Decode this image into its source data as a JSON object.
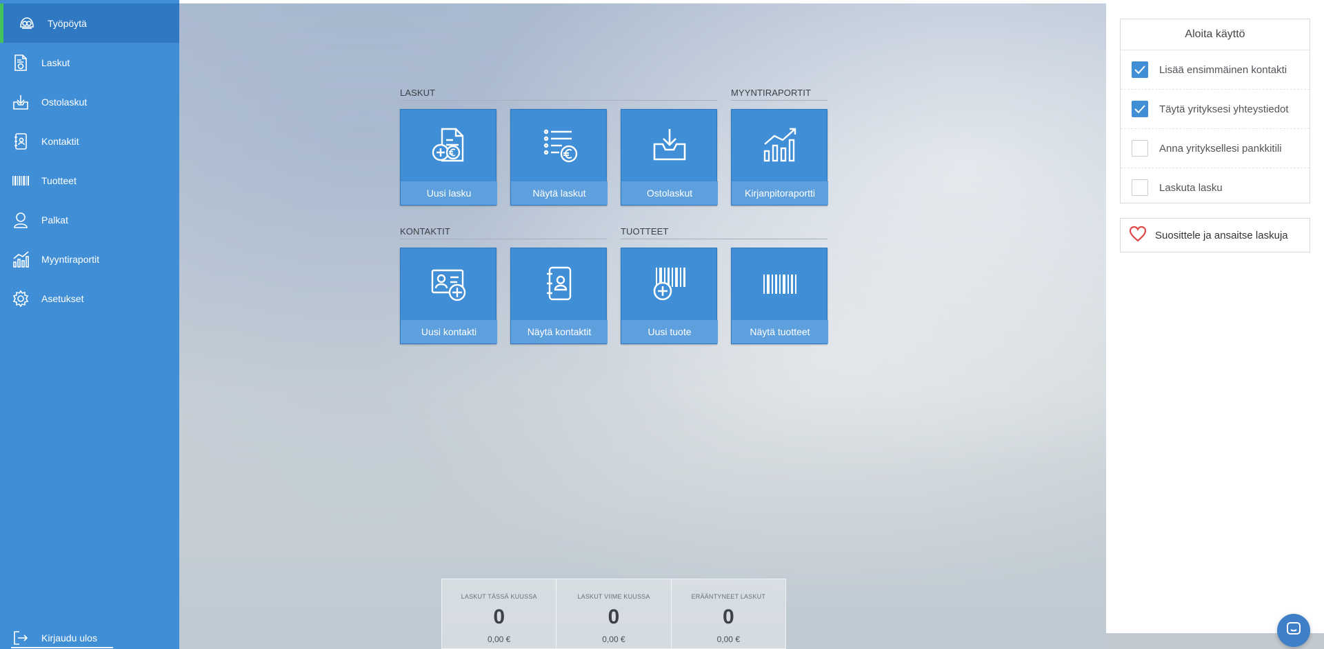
{
  "sidebar": {
    "items": [
      {
        "label": "Työpöytä",
        "icon": "dashboard-icon",
        "active": true
      },
      {
        "label": "Laskut",
        "icon": "invoice-icon"
      },
      {
        "label": "Ostolaskut",
        "icon": "inbox-icon"
      },
      {
        "label": "Kontaktit",
        "icon": "contact-book-icon"
      },
      {
        "label": "Tuotteet",
        "icon": "barcode-icon"
      },
      {
        "label": "Palkat",
        "icon": "person-icon"
      },
      {
        "label": "Myyntiraportit",
        "icon": "chart-icon"
      },
      {
        "label": "Asetukset",
        "icon": "gear-icon"
      }
    ],
    "logout": {
      "label": "Kirjaudu ulos",
      "icon": "logout-icon"
    }
  },
  "sections": {
    "laskut": "LASKUT",
    "myyntiraportit": "MYYNTIRAPORTIT",
    "kontaktit": "KONTAKTIT",
    "tuotteet": "TUOTTEET"
  },
  "tiles": {
    "new_invoice": "Uusi lasku",
    "show_invoices": "Näytä laskut",
    "purchase_invoices": "Ostolaskut",
    "accounting_report": "Kirjanpitoraportti",
    "new_contact": "Uusi kontakti",
    "show_contacts": "Näytä kontaktit",
    "new_product": "Uusi tuote",
    "show_products": "Näytä tuotteet"
  },
  "stats": [
    {
      "label": "LASKUT TÄSSÄ KUUSSA",
      "count": "0",
      "amount": "0,00 €"
    },
    {
      "label": "LASKUT VIIME KUUSSA",
      "count": "0",
      "amount": "0,00 €"
    },
    {
      "label": "ERÄÄNTYNEET LASKUT",
      "count": "0",
      "amount": "0,00 €"
    }
  ],
  "getting_started": {
    "title": "Aloita käyttö",
    "items": [
      {
        "label": "Lisää ensimmäinen kontakti",
        "checked": true
      },
      {
        "label": "Täytä yrityksesi yhteystiedot",
        "checked": true
      },
      {
        "label": "Anna yrityksellesi pankkitili",
        "checked": false
      },
      {
        "label": "Laskuta lasku",
        "checked": false
      }
    ]
  },
  "recommend": {
    "label": "Suosittele ja ansaitse laskuja",
    "icon": "heart-icon"
  },
  "chat": {
    "icon": "chat-icon"
  },
  "colors": {
    "primary": "#3f8ed6",
    "active": "#2f79c2",
    "active_marker": "#42c45a",
    "heart": "#e04848"
  }
}
